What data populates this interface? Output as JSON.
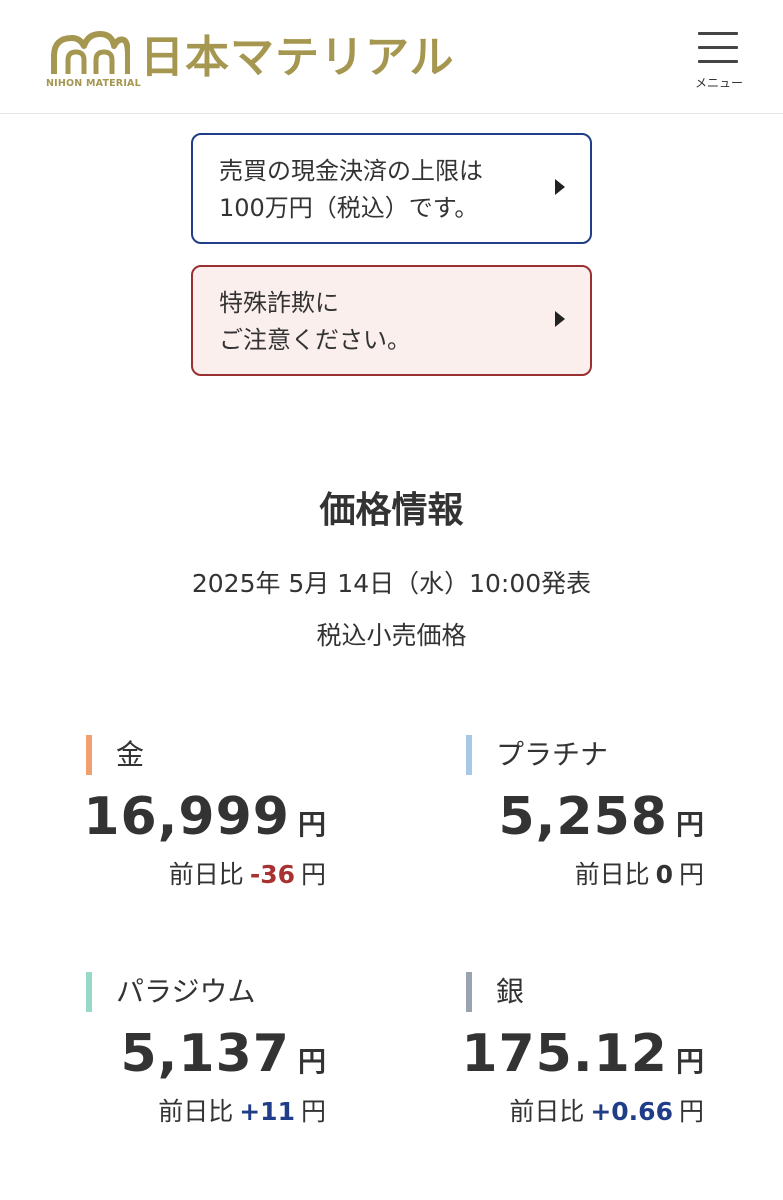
{
  "header": {
    "logo_name": "日本マテリアル",
    "logo_sub": "NIHON MATERIAL",
    "logo_color": "#a59650",
    "menu_label": "メニュー"
  },
  "notices": [
    {
      "line1": "売買の現金決済の上限は",
      "line2": "100万円（税込）です。",
      "style": "info",
      "border_color": "#1f3e87"
    },
    {
      "line1": "特殊詐欺に",
      "line2": "ご注意ください。",
      "style": "warning",
      "border_color": "#9b3030",
      "background": "#fbefee"
    }
  ],
  "price_info": {
    "title": "価格情報",
    "date": "2025年 5月 14日（水）10:00発表",
    "price_type": "税込小売価格",
    "change_label": "前日比",
    "metals": [
      {
        "name": "金",
        "price": "16,999",
        "unit": "円",
        "change": "-36",
        "change_unit": "円",
        "accent": "#f0a070",
        "change_color": "#a83232"
      },
      {
        "name": "プラチナ",
        "price": "5,258",
        "unit": "円",
        "change": "0",
        "change_unit": "円",
        "accent": "#a8c8e8",
        "change_color": "#333333"
      },
      {
        "name": "パラジウム",
        "price": "5,137",
        "unit": "円",
        "change": "+11",
        "change_unit": "円",
        "accent": "#98d8c8",
        "change_color": "#1f3e87"
      },
      {
        "name": "銀",
        "price": "175.12",
        "unit": "円",
        "change": "+0.66",
        "change_unit": "円",
        "accent": "#9aa2b0",
        "change_color": "#1f3e87"
      }
    ]
  }
}
